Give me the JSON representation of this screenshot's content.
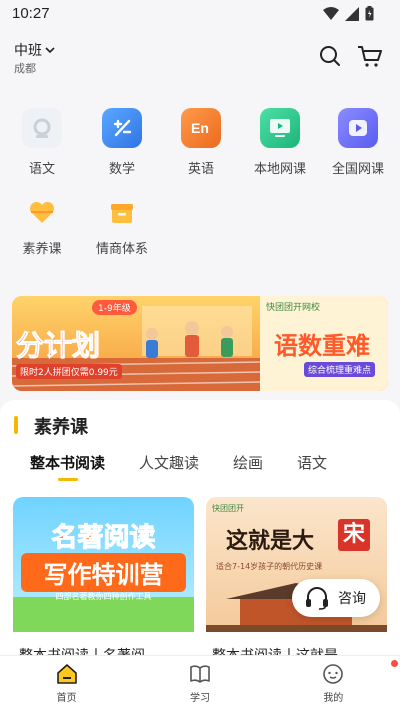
{
  "status_bar": {
    "time": "10:27"
  },
  "header": {
    "grade": "中班",
    "city": "成都"
  },
  "categories": [
    {
      "label": "语文",
      "icon": "chinese-book-icon",
      "color": "#e8ecf2"
    },
    {
      "label": "数学",
      "icon": "math-icon",
      "color": "#3a8cf0"
    },
    {
      "label": "英语",
      "icon": "english-icon",
      "color": "#f07a2a"
    },
    {
      "label": "本地网课",
      "icon": "local-class-icon",
      "color": "#2cc38a"
    },
    {
      "label": "全国网课",
      "icon": "national-class-icon",
      "color": "#6a6cf0"
    },
    {
      "label": "素养课",
      "icon": "heart-icon",
      "color": "#f7b23a"
    },
    {
      "label": "情商体系",
      "icon": "eq-box-icon",
      "color": "#f7b23a"
    }
  ],
  "banner": {
    "left_tag": "1-9年级",
    "left_big": "分计划",
    "left_sub": "限时2人拼团仅需0.99元",
    "right_brand": "快团团开网校",
    "right_big": "语数重难",
    "right_sub": "综合梳理重难点"
  },
  "section": {
    "title": "素养课",
    "tabs": [
      "整本书阅读",
      "人文趣读",
      "绘画",
      "语文"
    ],
    "active_tab": 0
  },
  "courses": [
    {
      "title": "整本书阅读丨名著阅",
      "poster_line1": "名著阅读",
      "poster_line2": "写作特训营",
      "poster_sub": "四部名著教你四种创作工具"
    },
    {
      "title": "整本书阅读丨这就是",
      "poster_brand": "快团团开",
      "poster_line1": "这就是大",
      "poster_mark": "宋",
      "poster_sub": "适合7-14岁孩子的朝代历史课"
    }
  ],
  "consult": {
    "label": "咨询"
  },
  "bottom_nav": [
    {
      "label": "首页",
      "icon": "home-icon"
    },
    {
      "label": "学习",
      "icon": "book-icon"
    },
    {
      "label": "我的",
      "icon": "profile-icon"
    }
  ]
}
